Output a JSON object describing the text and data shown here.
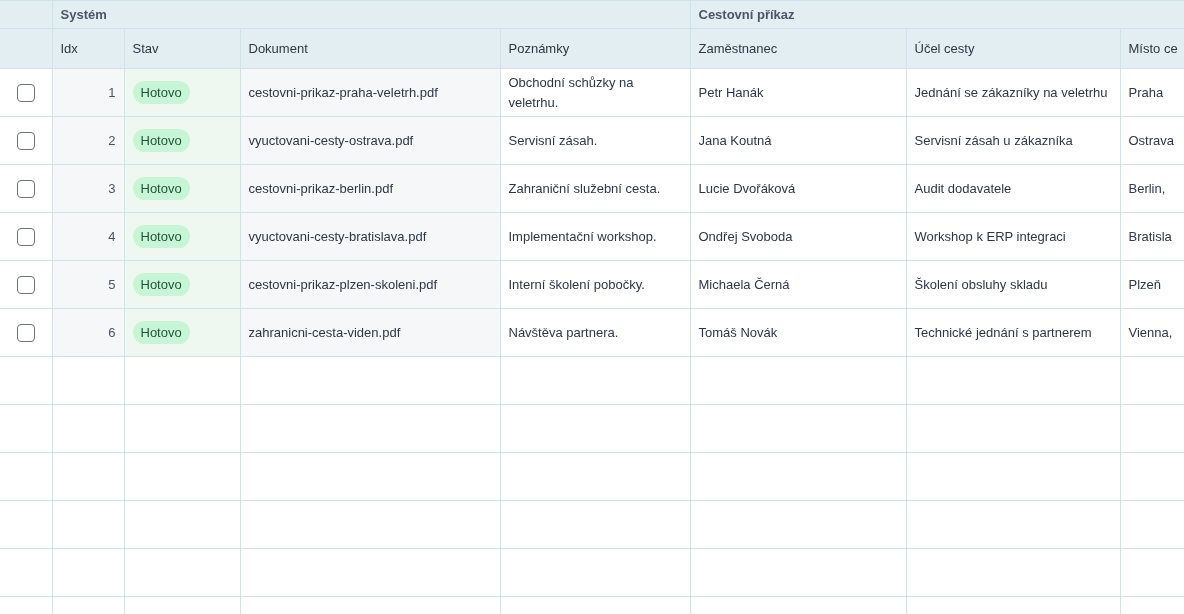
{
  "table": {
    "groups": [
      {
        "label": "Systém",
        "columns": [
          "Idx",
          "Stav",
          "Dokument",
          "Poznámky"
        ]
      },
      {
        "label": "Cestovní příkaz",
        "columns": [
          "Zaměstnanec",
          "Účel cesty",
          "Místo ce"
        ]
      }
    ],
    "rows": [
      {
        "checked": false,
        "idx": "1",
        "status": "Hotovo",
        "document": "cestovni-prikaz-praha-veletrh.pdf",
        "notes": "Obchodní schůzky na veletrhu.",
        "employee": "Petr Hanák",
        "purpose": "Jednání se zákazníky na veletrhu",
        "place": "Praha"
      },
      {
        "checked": false,
        "idx": "2",
        "status": "Hotovo",
        "document": "vyuctovani-cesty-ostrava.pdf",
        "notes": "Servisní zásah.",
        "employee": "Jana Koutná",
        "purpose": "Servisní zásah u zákazníka",
        "place": "Ostrava"
      },
      {
        "checked": false,
        "idx": "3",
        "status": "Hotovo",
        "document": "cestovni-prikaz-berlin.pdf",
        "notes": "Zahraniční služební cesta.",
        "employee": "Lucie Dvořáková",
        "purpose": "Audit dodavatele",
        "place": "Berlin,"
      },
      {
        "checked": false,
        "idx": "4",
        "status": "Hotovo",
        "document": "vyuctovani-cesty-bratislava.pdf",
        "notes": "Implementační workshop.",
        "employee": "Ondřej Svoboda",
        "purpose": "Workshop k ERP integraci",
        "place": "Bratisla"
      },
      {
        "checked": false,
        "idx": "5",
        "status": "Hotovo",
        "document": "cestovni-prikaz-plzen-skoleni.pdf",
        "notes": "Interní školení pobočky.",
        "employee": "Michaela Černá",
        "purpose": "Školení obsluhy skladu",
        "place": "Plzeň"
      },
      {
        "checked": false,
        "idx": "6",
        "status": "Hotovo",
        "document": "zahranicni-cesta-viden.pdf",
        "notes": "Návštěva partnera.",
        "employee": "Tomáš Novák",
        "purpose": "Technické jednání s partnerem",
        "place": "Vienna,"
      }
    ]
  }
}
